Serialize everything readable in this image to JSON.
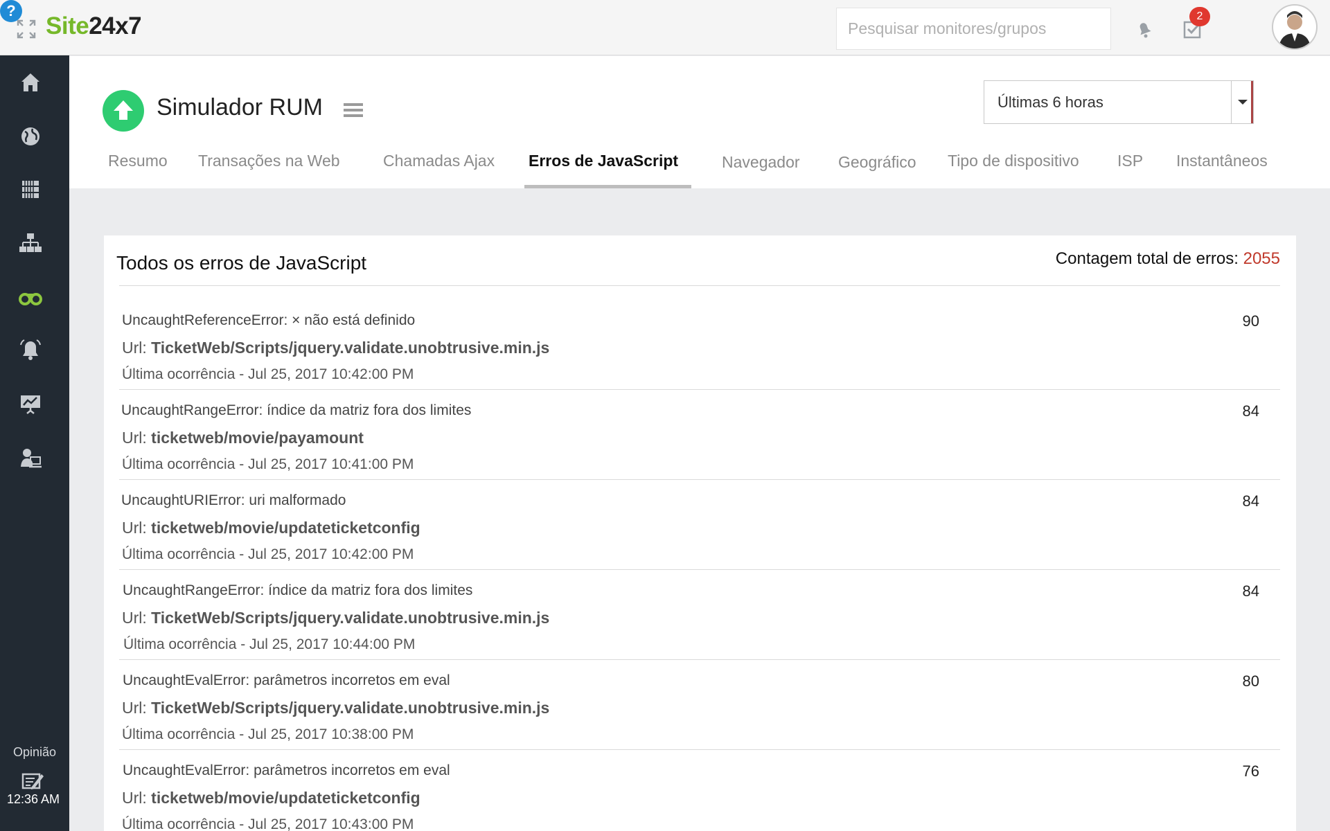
{
  "app": {
    "logo_site": "Site",
    "logo_num": "24x7"
  },
  "topbar": {
    "search_placeholder": "Pesquisar monitores/grupos",
    "notification_count": "2",
    "help_label": "?"
  },
  "sidebar": {
    "items": [
      "home-icon",
      "globe-icon",
      "server-icon",
      "network-icon",
      "binoculars-icon",
      "alarm-icon",
      "reports-icon",
      "admin-icon"
    ],
    "active_item": "binoculars-icon",
    "active_color": "#8cc63f",
    "feedback_label": "Opinião",
    "clock": "12:36 AM"
  },
  "monitor": {
    "title": "Simulador RUM",
    "status_color": "#2ecc71",
    "time_range": "Últimas 6 horas"
  },
  "tabs": [
    {
      "label": "Resumo"
    },
    {
      "label": "Transações na Web"
    },
    {
      "label": "Chamadas Ajax"
    },
    {
      "label": "Erros de JavaScript",
      "active": true
    },
    {
      "label": "Navegador"
    },
    {
      "label": "Geográfico"
    },
    {
      "label": "Tipo de dispositivo"
    },
    {
      "label": "ISP"
    },
    {
      "label": "Instantâneos"
    }
  ],
  "panel": {
    "title": "Todos os erros de JavaScript",
    "total_label": "Contagem total de erros: ",
    "total_count": "2055",
    "url_prefix": "Url: ",
    "errors": [
      {
        "message": "UncaughtReferenceError: × não está definido",
        "url": "TicketWeb/Scripts/jquery.validate.unobtrusive.min.js",
        "last": "Última ocorrência - Jul 25, 2017 10:42:00 PM",
        "count": "90"
      },
      {
        "message": "UncaughtRangeError: índice da matriz fora dos limites",
        "url": "ticketweb/movie/payamount",
        "last": "Última ocorrência - Jul 25, 2017 10:41:00 PM",
        "count": "84"
      },
      {
        "message": "UncaughtURIError: uri malformado",
        "url": "ticketweb/movie/updateticketconfig",
        "last": "Última ocorrência - Jul 25, 2017 10:42:00 PM",
        "count": "84"
      },
      {
        "message": "UncaughtRangeError: índice da matriz fora dos limites",
        "url": "TicketWeb/Scripts/jquery.validate.unobtrusive.min.js",
        "last": "Última ocorrência - Jul 25, 2017 10:44:00 PM",
        "count": "84"
      },
      {
        "message": "UncaughtEvalError: parâmetros incorretos em eval",
        "url": "TicketWeb/Scripts/jquery.validate.unobtrusive.min.js",
        "last": "Última ocorrência - Jul 25, 2017 10:38:00 PM",
        "count": "80"
      },
      {
        "message": "UncaughtEvalError: parâmetros incorretos em eval",
        "url": "ticketweb/movie/updateticketconfig",
        "last": "Última ocorrência - Jul 25, 2017 10:43:00 PM",
        "count": "76"
      }
    ]
  }
}
